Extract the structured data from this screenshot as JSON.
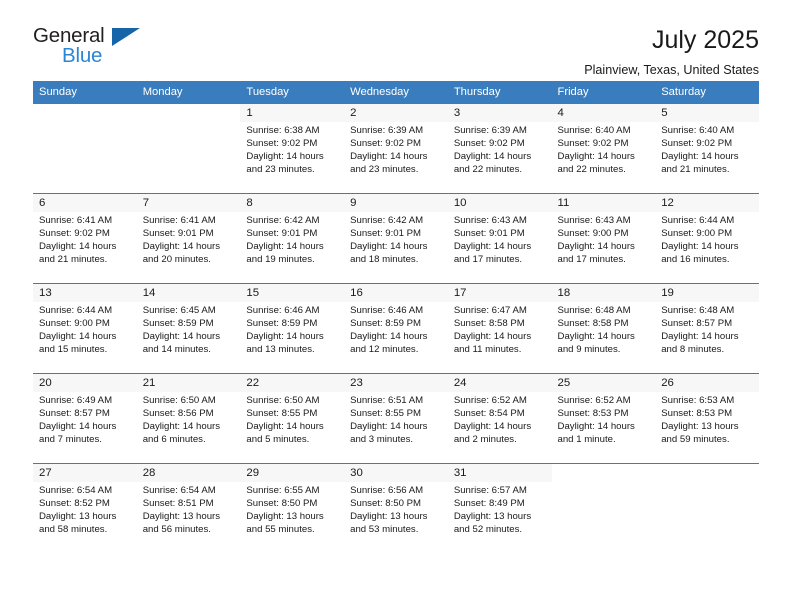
{
  "brand": {
    "name_part1": "General",
    "name_part2": "Blue",
    "triangle_color": "#1565a8",
    "blue_color": "#2b87d4"
  },
  "header": {
    "title": "July 2025",
    "subtitle": "Plainview, Texas, United States"
  },
  "theme": {
    "header_blue": "#3a7dbe",
    "row_divider_blue": "#3a7dbe",
    "daynum_band": "#f2f2f2"
  },
  "calendar": {
    "weekday_headers": [
      "Sunday",
      "Monday",
      "Tuesday",
      "Wednesday",
      "Thursday",
      "Friday",
      "Saturday"
    ],
    "weeks": [
      [
        {
          "day": "",
          "blank": true,
          "sunrise": "",
          "sunset": "",
          "daylight_line1": "",
          "daylight_line2": ""
        },
        {
          "day": "",
          "blank": true,
          "sunrise": "",
          "sunset": "",
          "daylight_line1": "",
          "daylight_line2": ""
        },
        {
          "day": "1",
          "sunrise": "Sunrise: 6:38 AM",
          "sunset": "Sunset: 9:02 PM",
          "daylight_line1": "Daylight: 14 hours",
          "daylight_line2": "and 23 minutes."
        },
        {
          "day": "2",
          "sunrise": "Sunrise: 6:39 AM",
          "sunset": "Sunset: 9:02 PM",
          "daylight_line1": "Daylight: 14 hours",
          "daylight_line2": "and 23 minutes."
        },
        {
          "day": "3",
          "sunrise": "Sunrise: 6:39 AM",
          "sunset": "Sunset: 9:02 PM",
          "daylight_line1": "Daylight: 14 hours",
          "daylight_line2": "and 22 minutes."
        },
        {
          "day": "4",
          "sunrise": "Sunrise: 6:40 AM",
          "sunset": "Sunset: 9:02 PM",
          "daylight_line1": "Daylight: 14 hours",
          "daylight_line2": "and 22 minutes."
        },
        {
          "day": "5",
          "sunrise": "Sunrise: 6:40 AM",
          "sunset": "Sunset: 9:02 PM",
          "daylight_line1": "Daylight: 14 hours",
          "daylight_line2": "and 21 minutes."
        }
      ],
      [
        {
          "day": "6",
          "sunrise": "Sunrise: 6:41 AM",
          "sunset": "Sunset: 9:02 PM",
          "daylight_line1": "Daylight: 14 hours",
          "daylight_line2": "and 21 minutes."
        },
        {
          "day": "7",
          "sunrise": "Sunrise: 6:41 AM",
          "sunset": "Sunset: 9:01 PM",
          "daylight_line1": "Daylight: 14 hours",
          "daylight_line2": "and 20 minutes."
        },
        {
          "day": "8",
          "sunrise": "Sunrise: 6:42 AM",
          "sunset": "Sunset: 9:01 PM",
          "daylight_line1": "Daylight: 14 hours",
          "daylight_line2": "and 19 minutes."
        },
        {
          "day": "9",
          "sunrise": "Sunrise: 6:42 AM",
          "sunset": "Sunset: 9:01 PM",
          "daylight_line1": "Daylight: 14 hours",
          "daylight_line2": "and 18 minutes."
        },
        {
          "day": "10",
          "sunrise": "Sunrise: 6:43 AM",
          "sunset": "Sunset: 9:01 PM",
          "daylight_line1": "Daylight: 14 hours",
          "daylight_line2": "and 17 minutes."
        },
        {
          "day": "11",
          "sunrise": "Sunrise: 6:43 AM",
          "sunset": "Sunset: 9:00 PM",
          "daylight_line1": "Daylight: 14 hours",
          "daylight_line2": "and 17 minutes."
        },
        {
          "day": "12",
          "sunrise": "Sunrise: 6:44 AM",
          "sunset": "Sunset: 9:00 PM",
          "daylight_line1": "Daylight: 14 hours",
          "daylight_line2": "and 16 minutes."
        }
      ],
      [
        {
          "day": "13",
          "sunrise": "Sunrise: 6:44 AM",
          "sunset": "Sunset: 9:00 PM",
          "daylight_line1": "Daylight: 14 hours",
          "daylight_line2": "and 15 minutes."
        },
        {
          "day": "14",
          "sunrise": "Sunrise: 6:45 AM",
          "sunset": "Sunset: 8:59 PM",
          "daylight_line1": "Daylight: 14 hours",
          "daylight_line2": "and 14 minutes."
        },
        {
          "day": "15",
          "sunrise": "Sunrise: 6:46 AM",
          "sunset": "Sunset: 8:59 PM",
          "daylight_line1": "Daylight: 14 hours",
          "daylight_line2": "and 13 minutes."
        },
        {
          "day": "16",
          "sunrise": "Sunrise: 6:46 AM",
          "sunset": "Sunset: 8:59 PM",
          "daylight_line1": "Daylight: 14 hours",
          "daylight_line2": "and 12 minutes."
        },
        {
          "day": "17",
          "sunrise": "Sunrise: 6:47 AM",
          "sunset": "Sunset: 8:58 PM",
          "daylight_line1": "Daylight: 14 hours",
          "daylight_line2": "and 11 minutes."
        },
        {
          "day": "18",
          "sunrise": "Sunrise: 6:48 AM",
          "sunset": "Sunset: 8:58 PM",
          "daylight_line1": "Daylight: 14 hours",
          "daylight_line2": "and 9 minutes."
        },
        {
          "day": "19",
          "sunrise": "Sunrise: 6:48 AM",
          "sunset": "Sunset: 8:57 PM",
          "daylight_line1": "Daylight: 14 hours",
          "daylight_line2": "and 8 minutes."
        }
      ],
      [
        {
          "day": "20",
          "sunrise": "Sunrise: 6:49 AM",
          "sunset": "Sunset: 8:57 PM",
          "daylight_line1": "Daylight: 14 hours",
          "daylight_line2": "and 7 minutes."
        },
        {
          "day": "21",
          "sunrise": "Sunrise: 6:50 AM",
          "sunset": "Sunset: 8:56 PM",
          "daylight_line1": "Daylight: 14 hours",
          "daylight_line2": "and 6 minutes."
        },
        {
          "day": "22",
          "sunrise": "Sunrise: 6:50 AM",
          "sunset": "Sunset: 8:55 PM",
          "daylight_line1": "Daylight: 14 hours",
          "daylight_line2": "and 5 minutes."
        },
        {
          "day": "23",
          "sunrise": "Sunrise: 6:51 AM",
          "sunset": "Sunset: 8:55 PM",
          "daylight_line1": "Daylight: 14 hours",
          "daylight_line2": "and 3 minutes."
        },
        {
          "day": "24",
          "sunrise": "Sunrise: 6:52 AM",
          "sunset": "Sunset: 8:54 PM",
          "daylight_line1": "Daylight: 14 hours",
          "daylight_line2": "and 2 minutes."
        },
        {
          "day": "25",
          "sunrise": "Sunrise: 6:52 AM",
          "sunset": "Sunset: 8:53 PM",
          "daylight_line1": "Daylight: 14 hours",
          "daylight_line2": "and 1 minute."
        },
        {
          "day": "26",
          "sunrise": "Sunrise: 6:53 AM",
          "sunset": "Sunset: 8:53 PM",
          "daylight_line1": "Daylight: 13 hours",
          "daylight_line2": "and 59 minutes."
        }
      ],
      [
        {
          "day": "27",
          "sunrise": "Sunrise: 6:54 AM",
          "sunset": "Sunset: 8:52 PM",
          "daylight_line1": "Daylight: 13 hours",
          "daylight_line2": "and 58 minutes."
        },
        {
          "day": "28",
          "sunrise": "Sunrise: 6:54 AM",
          "sunset": "Sunset: 8:51 PM",
          "daylight_line1": "Daylight: 13 hours",
          "daylight_line2": "and 56 minutes."
        },
        {
          "day": "29",
          "sunrise": "Sunrise: 6:55 AM",
          "sunset": "Sunset: 8:50 PM",
          "daylight_line1": "Daylight: 13 hours",
          "daylight_line2": "and 55 minutes."
        },
        {
          "day": "30",
          "sunrise": "Sunrise: 6:56 AM",
          "sunset": "Sunset: 8:50 PM",
          "daylight_line1": "Daylight: 13 hours",
          "daylight_line2": "and 53 minutes."
        },
        {
          "day": "31",
          "sunrise": "Sunrise: 6:57 AM",
          "sunset": "Sunset: 8:49 PM",
          "daylight_line1": "Daylight: 13 hours",
          "daylight_line2": "and 52 minutes."
        },
        {
          "day": "",
          "blank": true,
          "sunrise": "",
          "sunset": "",
          "daylight_line1": "",
          "daylight_line2": ""
        },
        {
          "day": "",
          "blank": true,
          "sunrise": "",
          "sunset": "",
          "daylight_line1": "",
          "daylight_line2": ""
        }
      ]
    ]
  }
}
